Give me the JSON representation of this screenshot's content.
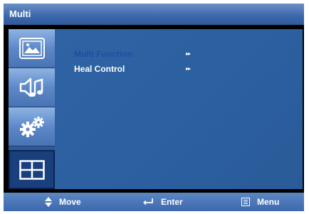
{
  "window": {
    "title": "Multi"
  },
  "sidebar": {
    "items": [
      {
        "name": "picture",
        "icon": "picture-icon"
      },
      {
        "name": "sound",
        "icon": "sound-icon"
      },
      {
        "name": "setup",
        "icon": "gears-icon"
      },
      {
        "name": "multi",
        "icon": "multi-window-icon",
        "active": true
      }
    ]
  },
  "menu": {
    "items": [
      {
        "label": "Multi Function",
        "arrow": "▸▸",
        "selected": true
      },
      {
        "label": "Heal Control",
        "arrow": "▸▸",
        "selected": false
      }
    ]
  },
  "footer": {
    "move_label": "Move",
    "enter_label": "Enter",
    "menu_label": "Menu"
  },
  "colors": {
    "selected_text": "#1d4fa0",
    "panel": "#2f64a4",
    "sidebar_active": "#1a3f7d"
  }
}
